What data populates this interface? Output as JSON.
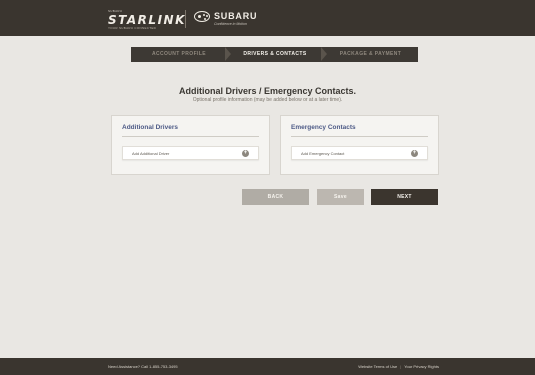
{
  "header": {
    "brand_top": "SUBARU",
    "brand_name": "STARLINK",
    "brand_tagline": "YOUR SUBARU CONNECTED",
    "partner_name": "SUBARU",
    "partner_tagline": "Confidence in Motion"
  },
  "steps": [
    {
      "label": "ACCOUNT PROFILE",
      "active": false
    },
    {
      "label": "DRIVERS & CONTACTS",
      "active": true
    },
    {
      "label": "PACKAGE & PAYMENT",
      "active": false
    }
  ],
  "page": {
    "title": "Additional Drivers / Emergency Contacts.",
    "subtitle": "Optional profile information (may be added below or at a later time)."
  },
  "panels": {
    "drivers": {
      "title": "Additional Drivers",
      "add_label": "Add Additional Driver"
    },
    "contacts": {
      "title": "Emergency Contacts",
      "add_label": "Add Emergency Contact"
    }
  },
  "buttons": {
    "back": "BACK",
    "save": "Save",
    "next": "NEXT"
  },
  "footer": {
    "help": "Need Assistance? Call 1-855-753-3495",
    "terms": "Website Terms of Use",
    "separator": "|",
    "privacy": "Your Privacy Rights"
  },
  "colors": {
    "header_bg": "#3a352f",
    "accent_title": "#4d5a86",
    "next_button": "#3b352e"
  }
}
